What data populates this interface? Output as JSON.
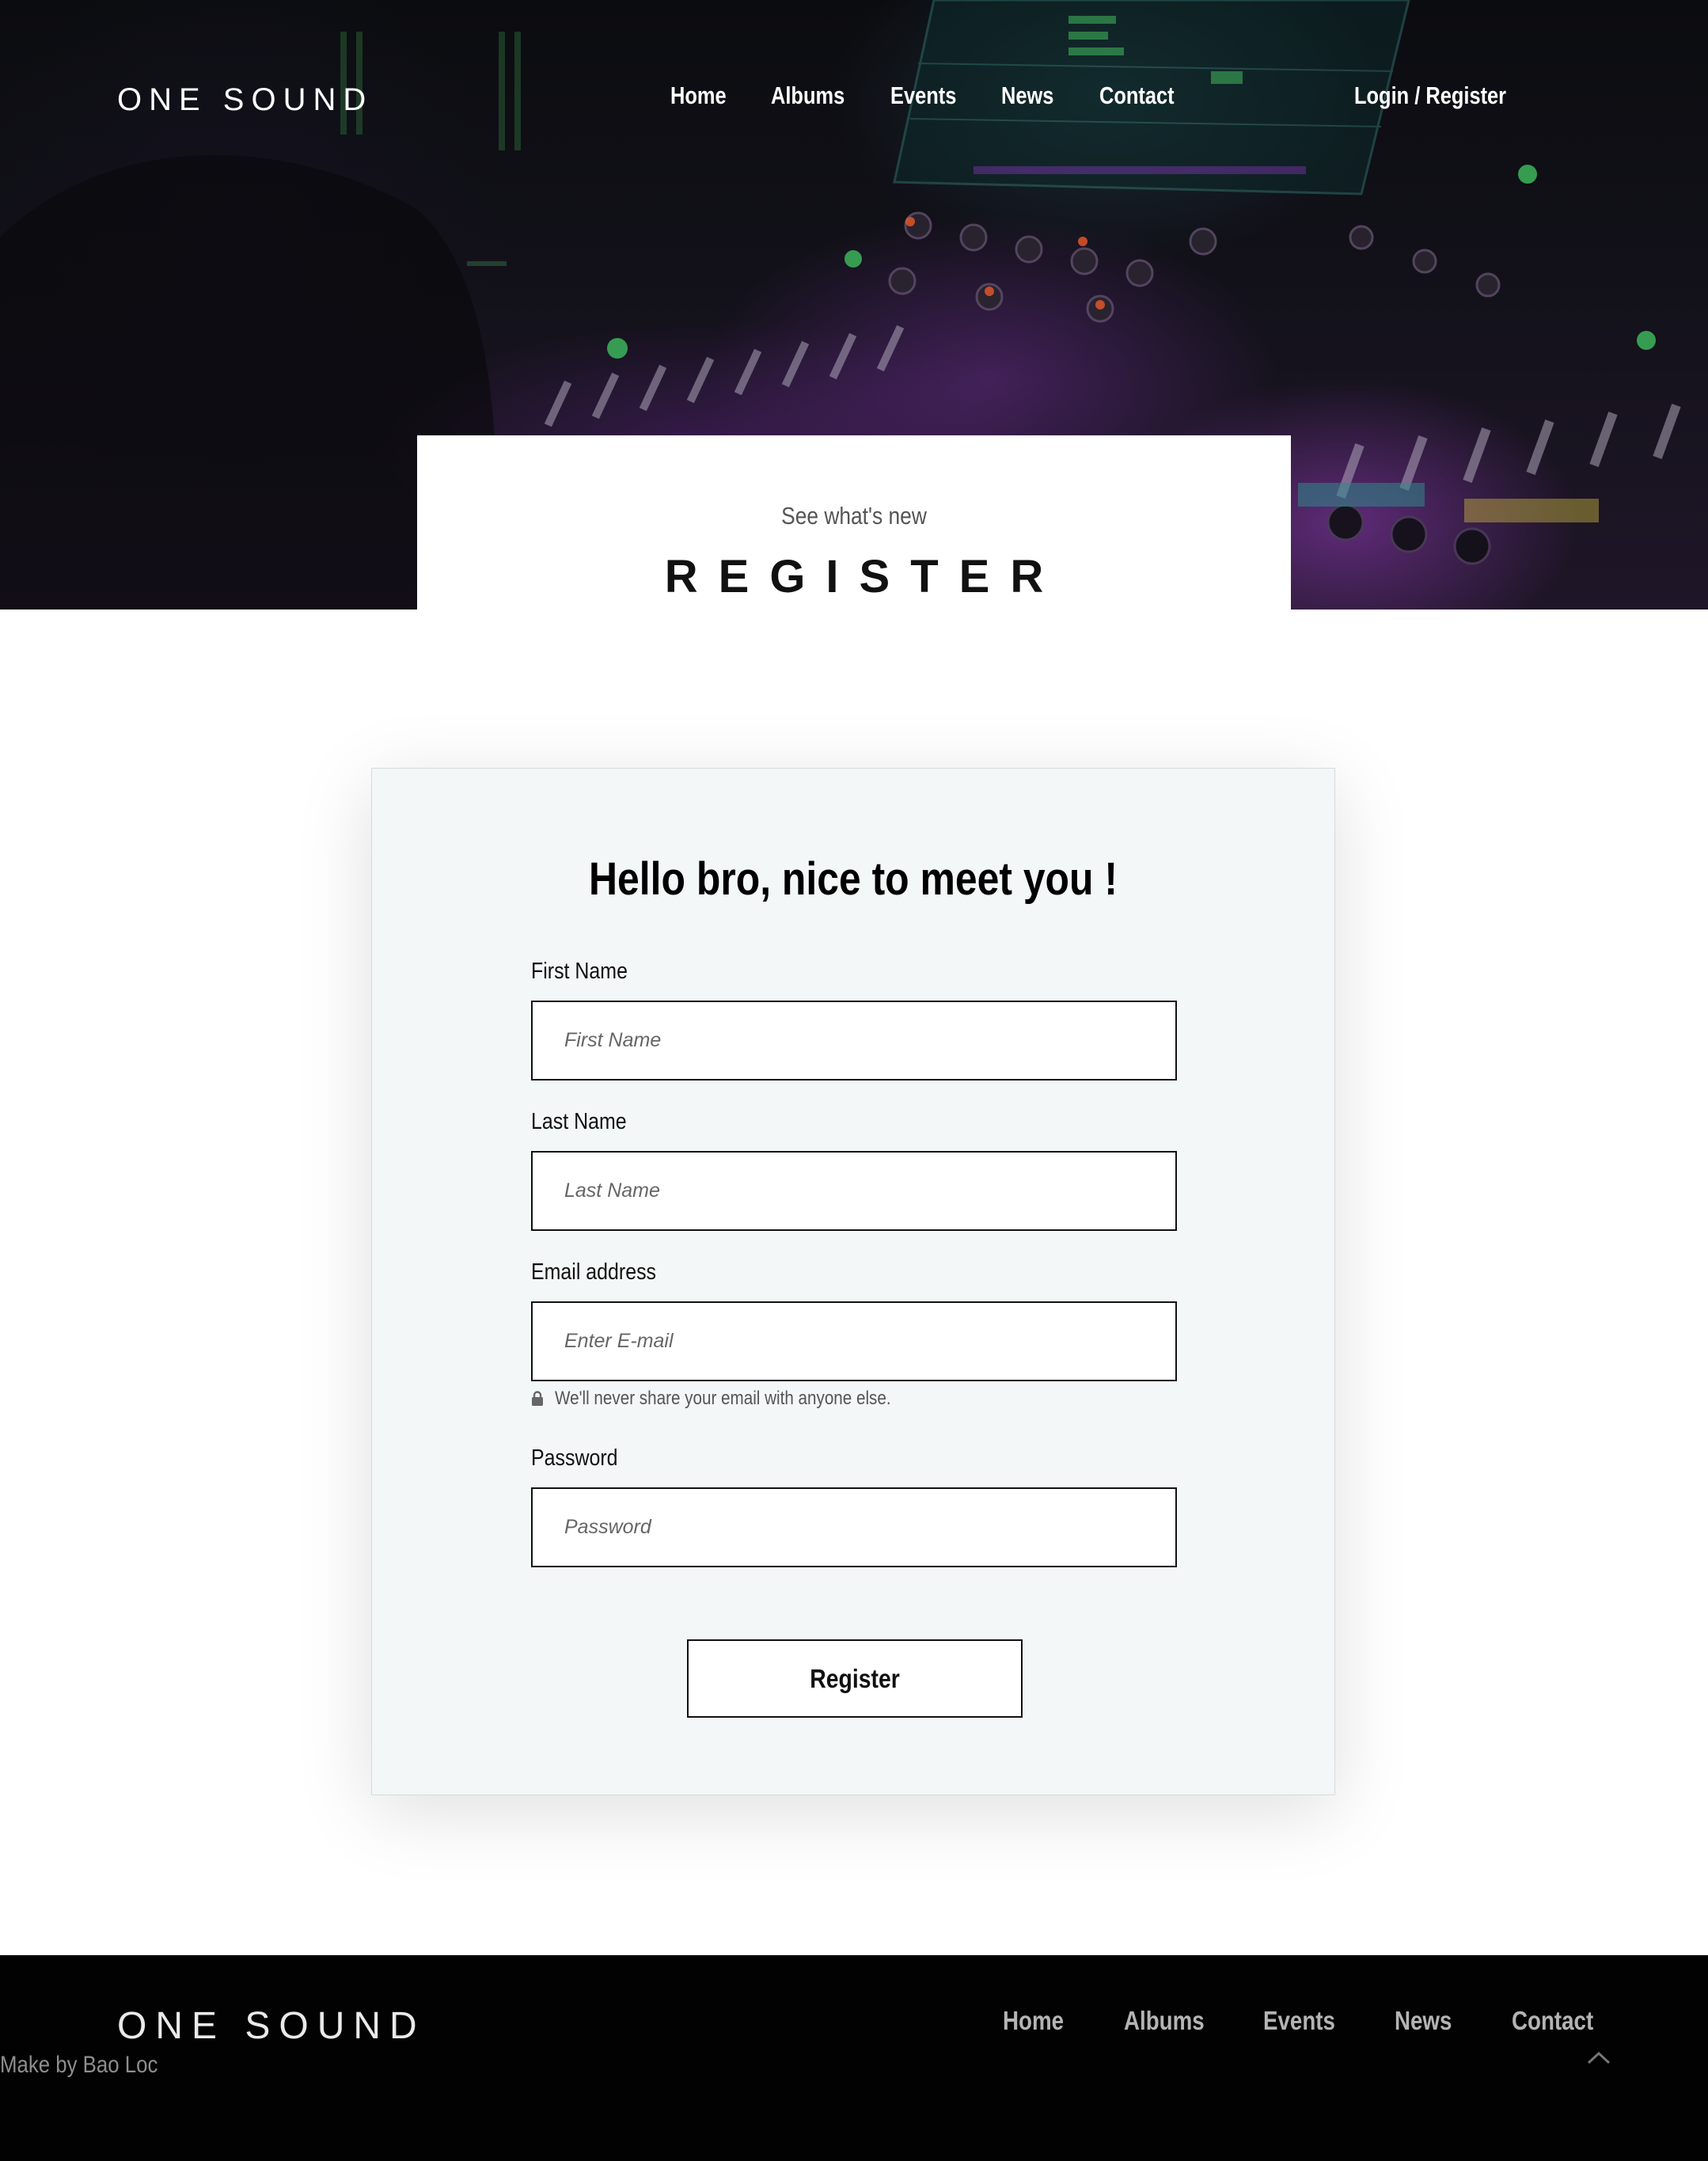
{
  "header": {
    "logo": "ONE SOUND",
    "nav": [
      {
        "label": "Home"
      },
      {
        "label": "Albums"
      },
      {
        "label": "Events"
      },
      {
        "label": "News"
      },
      {
        "label": "Contact"
      }
    ],
    "auth_link": "Login / Register"
  },
  "hero": {
    "eyebrow": "See what's new",
    "title": "REGISTER"
  },
  "form": {
    "title": "Hello bro, nice to meet you !",
    "fields": [
      {
        "label": "First Name",
        "placeholder": "First Name",
        "value": ""
      },
      {
        "label": "Last Name",
        "placeholder": "Last Name",
        "value": ""
      },
      {
        "label": "Email address",
        "placeholder": "Enter E-mail",
        "value": ""
      },
      {
        "label": "Password",
        "placeholder": "Password",
        "value": ""
      }
    ],
    "email_help": "We'll never share your email with anyone else.",
    "submit_label": "Register"
  },
  "footer": {
    "logo": "ONE SOUND",
    "nav": [
      {
        "label": "Home"
      },
      {
        "label": "Albums"
      },
      {
        "label": "Events"
      },
      {
        "label": "News"
      },
      {
        "label": "Contact"
      }
    ],
    "credit": "Make by Bao Loc"
  },
  "icons": {
    "email_help_icon": "lock-icon",
    "back_to_top_icon": "chevron-up-icon"
  },
  "colors": {
    "footer_bg": "#020202",
    "form_bg": "#f4f7f7",
    "text": "#111111",
    "hero_tint": "#7a3d9a"
  }
}
